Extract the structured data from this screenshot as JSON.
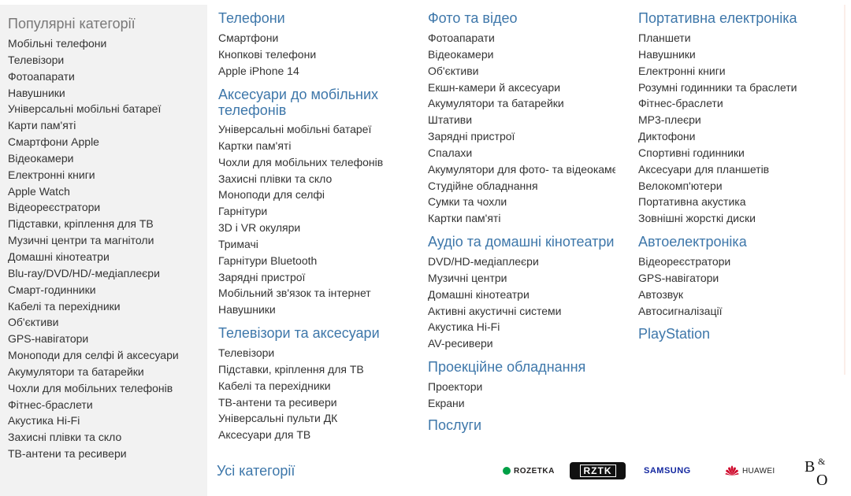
{
  "popular": {
    "title": "Популярні категорії",
    "items": [
      "Мобільні телефони",
      "Телевізори",
      "Фотоапарати",
      "Навушники",
      "Універсальні мобільні батареї",
      "Карти пам'яті",
      "Смартфони Apple",
      "Відеокамери",
      "Електронні книги",
      "Apple Watch",
      "Відеореєстратори",
      "Підставки, кріплення для ТВ",
      "Музичні центри та магнітоли",
      "Домашні кінотеатри",
      "Blu-ray/DVD/HD/-медіаплеєри",
      "Смарт-годинники",
      "Кабелі та перехідники",
      "Об'єктиви",
      "GPS-навігатори",
      "Моноподи для селфі й аксесуари",
      "Акумулятори та батарейки",
      "Чохли для мобільних телефонів",
      "Фітнес-браслети",
      "Акустика Hi-Fi",
      "Захисні плівки та скло",
      "ТВ-антени та ресивери"
    ]
  },
  "col1": [
    {
      "title": "Телефони",
      "items": [
        "Смартфони",
        "Кнопкові телефони",
        "Apple iPhone 14"
      ]
    },
    {
      "title": "Аксесуари до мобільних телефонів",
      "items": [
        "Універсальні мобільні батареї",
        "Картки пам'яті",
        "Чохли для мобільних телефонів",
        "Захисні плівки та скло",
        "Моноподи для селфі",
        "Гарнітури",
        "3D і VR окуляри",
        "Тримачі",
        "Гарнітури Bluetooth",
        "Зарядні пристрої",
        "Мобільний зв'язок та інтернет",
        "Навушники"
      ]
    },
    {
      "title": "Телевізори та аксесуари",
      "items": [
        "Телевізори",
        "Підставки, кріплення для ТВ",
        "Кабелі та перехідники",
        "ТВ-антени та ресивери",
        "Універсальні пульти ДК",
        "Аксесуари для ТВ"
      ]
    }
  ],
  "col2": [
    {
      "title": "Фото та відео",
      "items": [
        "Фотоапарати",
        "Відеокамери",
        "Об'єктиви",
        "Екшн-камери й аксесуари",
        "Акумулятори та батарейки",
        "Штативи",
        "Зарядні пристрої",
        "Спалахи",
        "Акумулятори для фото- та відеокамер",
        "Студійне обладнання",
        "Сумки та чохли",
        "Картки пам'яті"
      ]
    },
    {
      "title": "Аудіо та домашні кінотеатри",
      "items": [
        "DVD/HD-медіаплеєри",
        "Музичні центри",
        "Домашні кінотеатри",
        "Активні акустичні системи",
        "Акустика Hi-Fi",
        "AV-ресивери"
      ]
    },
    {
      "title": "Проекційне обладнання",
      "items": [
        "Проектори",
        "Екрани"
      ]
    },
    {
      "title": "Послуги",
      "items": []
    }
  ],
  "col3": [
    {
      "title": "Портативна електроніка",
      "items": [
        "Планшети",
        "Навушники",
        "Електронні книги",
        "Розумні годинники та браслети",
        "Фітнес-браслети",
        "MP3-плеєри",
        "Диктофони",
        "Спортивні годинники",
        "Аксесуари для планшетів",
        "Велокомп'ютери",
        "Портативна акустика",
        "Зовнішні жорсткі диски"
      ]
    },
    {
      "title": "Автоелектроніка",
      "items": [
        "Відеореєстратори",
        "GPS-навігатори",
        "Автозвук",
        "Автосигналізації"
      ]
    },
    {
      "title": "PlayStation",
      "items": []
    }
  ],
  "all_categories": "Усі категорії",
  "brands": {
    "rozetka": "ROZETKA",
    "rztk": "RZTK",
    "samsung": "SAMSUNG",
    "huawei": "HUAWEI",
    "bo": "B&O"
  },
  "colors": {
    "link": "#3e77aa",
    "text": "#333333",
    "popular_bg": "#f2f2f2",
    "popular_title": "#797878",
    "rozetka_green": "#00a046",
    "samsung_blue": "#1428a0",
    "huawei_red": "#cf0a2c"
  }
}
